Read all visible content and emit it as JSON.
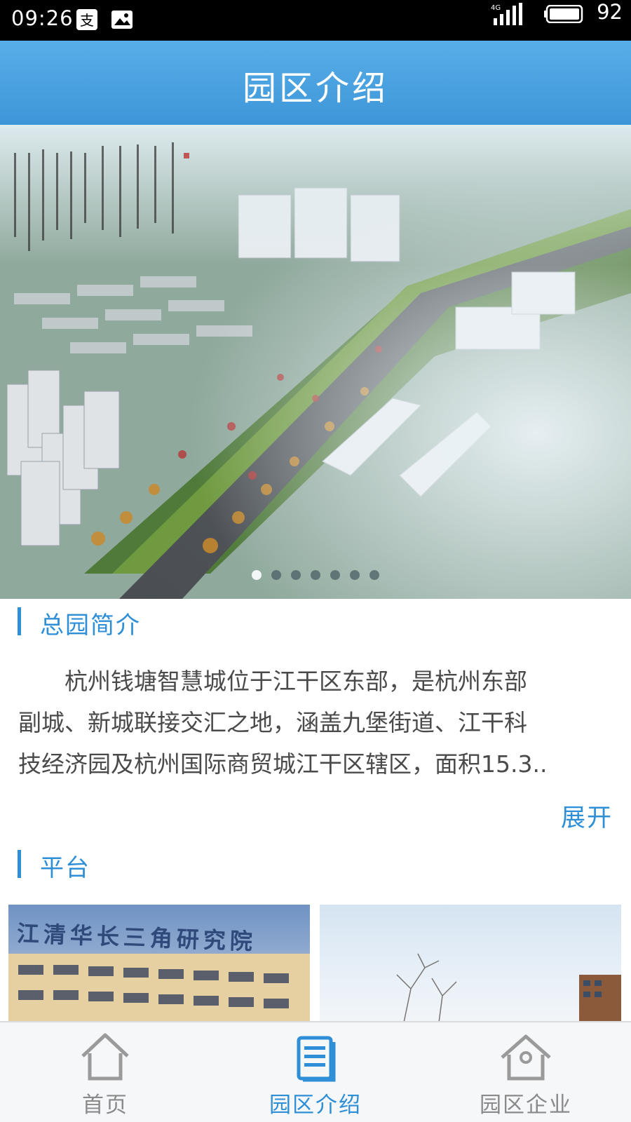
{
  "status_bar": {
    "time": "09:26",
    "network": "4G",
    "battery_level": "92"
  },
  "header": {
    "title": "园区介绍"
  },
  "banner": {
    "slide_count": 7,
    "active_index": 0
  },
  "intro": {
    "heading": "总园简介",
    "lines": [
      "　　杭州钱塘智慧城位于江干区东部，是杭州东部",
      "副城、新城联接交汇之地，涵盖九堡街道、江干科",
      "技经济园及杭州国际商贸城江干区辖区，面积15.3.."
    ],
    "expand_label": "展开"
  },
  "platform": {
    "heading": "平台",
    "cards": [
      {
        "sign_text": "江清华长三角研究院"
      },
      {
        "sign_text": ""
      }
    ]
  },
  "bottom_nav": {
    "items": [
      {
        "label": "首页",
        "icon": "home-icon",
        "active": false
      },
      {
        "label": "园区介绍",
        "icon": "document-icon",
        "active": true
      },
      {
        "label": "园区企业",
        "icon": "enterprise-house-icon",
        "active": false
      }
    ]
  },
  "colors": {
    "accent": "#2f8fd6",
    "header_top": "#58aee8",
    "header_bottom": "#3d96d8",
    "nav_inactive": "#8a8a8a"
  }
}
